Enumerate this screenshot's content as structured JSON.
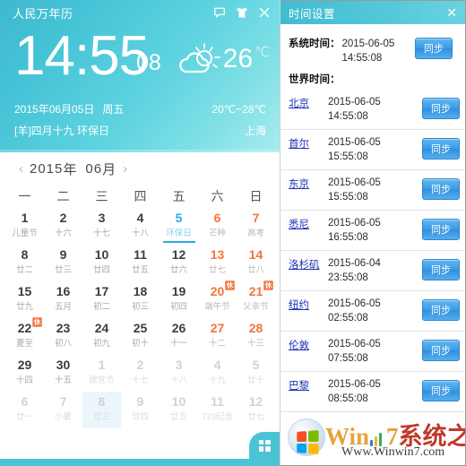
{
  "calendar_widget": {
    "app_title": "人民万年历",
    "title_icons": [
      {
        "name": "feedback-icon",
        "glyph": "speech-bubble"
      },
      {
        "name": "skin-icon",
        "glyph": "t-shirt"
      },
      {
        "name": "close-icon",
        "glyph": "x"
      }
    ],
    "clock": {
      "time": "14:55",
      "seconds": "08"
    },
    "weather": {
      "icon": "sun-behind-cloud-icon",
      "dash": "-",
      "temperature": "26",
      "unit": "℃",
      "range": "20℃~28℃",
      "city": "上海"
    },
    "date_line": {
      "solar": "2015年06月05日",
      "weekday": "周五",
      "lunar": "[羊]四月十九 环保日"
    },
    "month_nav": {
      "prev": "‹",
      "next": "›",
      "year": "2015",
      "year_unit": "年",
      "month": "06",
      "month_unit": "月"
    },
    "weekday_headers": [
      "一",
      "二",
      "三",
      "四",
      "五",
      "六",
      "日"
    ],
    "weeks": [
      [
        {
          "day": "1",
          "lunar": "儿童节",
          "type": "normal"
        },
        {
          "day": "2",
          "lunar": "十六",
          "type": "normal"
        },
        {
          "day": "3",
          "lunar": "十七",
          "type": "normal"
        },
        {
          "day": "4",
          "lunar": "十八",
          "type": "normal"
        },
        {
          "day": "5",
          "lunar": "环保日",
          "type": "today"
        },
        {
          "day": "6",
          "lunar": "芒种",
          "type": "weekend"
        },
        {
          "day": "7",
          "lunar": "高考",
          "type": "weekend"
        }
      ],
      [
        {
          "day": "8",
          "lunar": "廿二",
          "type": "normal"
        },
        {
          "day": "9",
          "lunar": "廿三",
          "type": "normal"
        },
        {
          "day": "10",
          "lunar": "廿四",
          "type": "normal"
        },
        {
          "day": "11",
          "lunar": "廿五",
          "type": "normal"
        },
        {
          "day": "12",
          "lunar": "廿六",
          "type": "normal"
        },
        {
          "day": "13",
          "lunar": "廿七",
          "type": "weekend"
        },
        {
          "day": "14",
          "lunar": "廿八",
          "type": "weekend"
        }
      ],
      [
        {
          "day": "15",
          "lunar": "廿九",
          "type": "normal"
        },
        {
          "day": "16",
          "lunar": "五月",
          "type": "normal"
        },
        {
          "day": "17",
          "lunar": "初二",
          "type": "normal"
        },
        {
          "day": "18",
          "lunar": "初三",
          "type": "normal"
        },
        {
          "day": "19",
          "lunar": "初四",
          "type": "normal"
        },
        {
          "day": "20",
          "lunar": "端午节",
          "type": "weekend",
          "badge": "休"
        },
        {
          "day": "21",
          "lunar": "父亲节",
          "type": "weekend",
          "badge": "休"
        }
      ],
      [
        {
          "day": "22",
          "lunar": "夏至",
          "type": "normal",
          "badge": "休"
        },
        {
          "day": "23",
          "lunar": "初八",
          "type": "normal"
        },
        {
          "day": "24",
          "lunar": "初九",
          "type": "normal"
        },
        {
          "day": "25",
          "lunar": "初十",
          "type": "normal"
        },
        {
          "day": "26",
          "lunar": "十一",
          "type": "normal"
        },
        {
          "day": "27",
          "lunar": "十二",
          "type": "weekend"
        },
        {
          "day": "28",
          "lunar": "十三",
          "type": "weekend"
        }
      ],
      [
        {
          "day": "29",
          "lunar": "十四",
          "type": "normal"
        },
        {
          "day": "30",
          "lunar": "十五",
          "type": "normal"
        },
        {
          "day": "1",
          "lunar": "建党节",
          "type": "other"
        },
        {
          "day": "2",
          "lunar": "十七",
          "type": "other"
        },
        {
          "day": "3",
          "lunar": "十八",
          "type": "other"
        },
        {
          "day": "4",
          "lunar": "十九",
          "type": "other"
        },
        {
          "day": "5",
          "lunar": "廿十",
          "type": "other"
        }
      ],
      [
        {
          "day": "6",
          "lunar": "廿一",
          "type": "other"
        },
        {
          "day": "7",
          "lunar": "小暑",
          "type": "other"
        },
        {
          "day": "8",
          "lunar": "廿三",
          "type": "other",
          "hover": true
        },
        {
          "day": "9",
          "lunar": "廿四",
          "type": "other"
        },
        {
          "day": "10",
          "lunar": "廿五",
          "type": "other"
        },
        {
          "day": "11",
          "lunar": "723纪念",
          "type": "other"
        },
        {
          "day": "12",
          "lunar": "廿七",
          "type": "other"
        }
      ]
    ],
    "corner_button": "apps-grid-icon"
  },
  "time_settings": {
    "title": "时间设置",
    "close": "✕",
    "system_label": "系统时间：",
    "system_date": "2015-06-05",
    "system_time": "14:55:08",
    "sync_label": "同步",
    "world_label": "世界时间：",
    "cities": [
      {
        "name": "北京",
        "date": "2015-06-05",
        "time": "14:55:08",
        "sync": "同步"
      },
      {
        "name": "首尔",
        "date": "2015-06-05",
        "time": "15:55:08",
        "sync": "同步"
      },
      {
        "name": "东京",
        "date": "2015-06-05",
        "time": "15:55:08",
        "sync": "同步"
      },
      {
        "name": "悉尼",
        "date": "2015-06-05",
        "time": "16:55:08",
        "sync": "同步"
      },
      {
        "name": "洛杉矶",
        "date": "2015-06-04",
        "time": "23:55:08",
        "sync": "同步"
      },
      {
        "name": "纽约",
        "date": "2015-06-05",
        "time": "02:55:08",
        "sync": "同步"
      },
      {
        "name": "伦敦",
        "date": "2015-06-05",
        "time": "07:55:08",
        "sync": "同步"
      },
      {
        "name": "巴黎",
        "date": "2015-06-05",
        "time": "08:55:08",
        "sync": "同步"
      }
    ]
  },
  "watermark": {
    "brand_win": "Win",
    "brand_seven": "7",
    "brand_rest": "系统之家",
    "url": "Www.Winwin7.com"
  },
  "colors": {
    "header_teal": "#4bc3d4",
    "accent_blue": "#29abe2",
    "weekend_orange": "#f4743b",
    "rest_badge": "#f4743b",
    "sync_blue": "#3b9ae4",
    "city_link": "#1a32b6"
  }
}
